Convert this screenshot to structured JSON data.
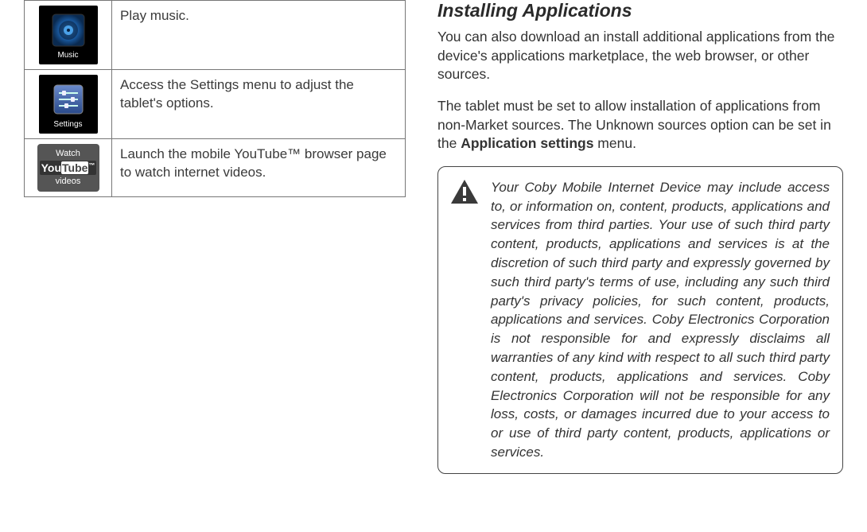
{
  "apps_table": {
    "rows": [
      {
        "icon_label": "Music",
        "desc": "Play music."
      },
      {
        "icon_label": "Settings",
        "desc": "Access the Settings menu to adjust the tablet's options."
      },
      {
        "icon_label": "Watch YouTube videos",
        "desc": "Launch the mobile YouTube™ browser page to watch internet videos."
      }
    ]
  },
  "right": {
    "heading": "Installing Applications",
    "para1": "You can also download an install additional applications from the device's applications marketplace, the web browser, or other sources.",
    "para2_a": "The tablet must be set to allow installation of applications from non-Market sources. The Unknown sources option can be set in the ",
    "para2_bold": "Application settings",
    "para2_b": " menu.",
    "warning": "Your Coby Mobile Internet Device may include access to, or information on, content, products, applications and services from third parties. Your use of such third party content, products, applications and services is at the discretion of such third party and expressly governed by such third party's terms of use, including any such third party's privacy policies, for such content, products, applications and services. Coby Electronics Corporation is not responsible for and expressly disclaims all warranties of any kind with respect to all such third party content, products, applications and services. Coby Electronics Corporation will not be responsible for any loss, costs, or damages incurred due to your access to or use of third party content, products, applications or services."
  }
}
